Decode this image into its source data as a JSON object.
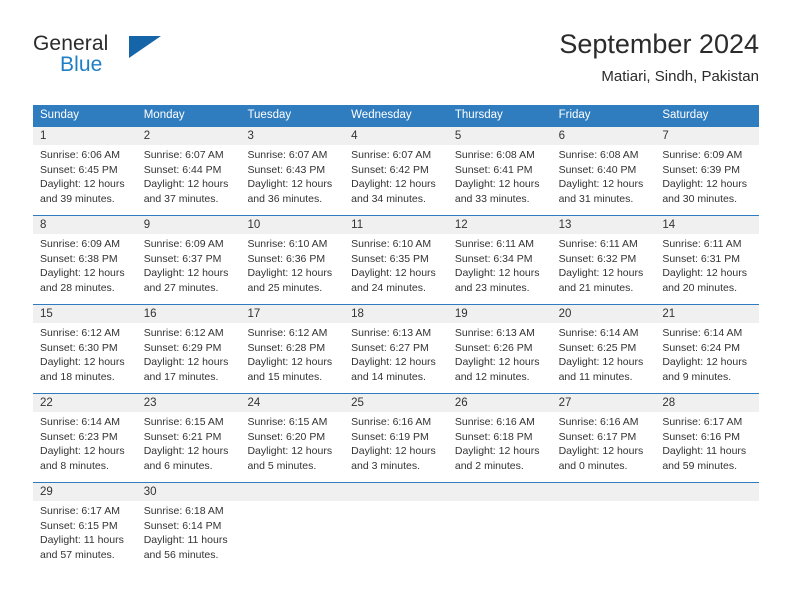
{
  "brand": {
    "name_part1": "General",
    "name_part2": "Blue",
    "triangle_color": "#1565a8",
    "blue_color": "#1f7fc4"
  },
  "header": {
    "title": "September 2024",
    "subtitle": "Matiari, Sindh, Pakistan"
  },
  "theme": {
    "header_blue": "#2f7cbf",
    "daynum_band": "#f0f0f0",
    "text": "#333333"
  },
  "weekdays": [
    "Sunday",
    "Monday",
    "Tuesday",
    "Wednesday",
    "Thursday",
    "Friday",
    "Saturday"
  ],
  "weeks": [
    [
      {
        "day": "1",
        "sunrise": "Sunrise: 6:06 AM",
        "sunset": "Sunset: 6:45 PM",
        "daylight1": "Daylight: 12 hours",
        "daylight2": "and 39 minutes."
      },
      {
        "day": "2",
        "sunrise": "Sunrise: 6:07 AM",
        "sunset": "Sunset: 6:44 PM",
        "daylight1": "Daylight: 12 hours",
        "daylight2": "and 37 minutes."
      },
      {
        "day": "3",
        "sunrise": "Sunrise: 6:07 AM",
        "sunset": "Sunset: 6:43 PM",
        "daylight1": "Daylight: 12 hours",
        "daylight2": "and 36 minutes."
      },
      {
        "day": "4",
        "sunrise": "Sunrise: 6:07 AM",
        "sunset": "Sunset: 6:42 PM",
        "daylight1": "Daylight: 12 hours",
        "daylight2": "and 34 minutes."
      },
      {
        "day": "5",
        "sunrise": "Sunrise: 6:08 AM",
        "sunset": "Sunset: 6:41 PM",
        "daylight1": "Daylight: 12 hours",
        "daylight2": "and 33 minutes."
      },
      {
        "day": "6",
        "sunrise": "Sunrise: 6:08 AM",
        "sunset": "Sunset: 6:40 PM",
        "daylight1": "Daylight: 12 hours",
        "daylight2": "and 31 minutes."
      },
      {
        "day": "7",
        "sunrise": "Sunrise: 6:09 AM",
        "sunset": "Sunset: 6:39 PM",
        "daylight1": "Daylight: 12 hours",
        "daylight2": "and 30 minutes."
      }
    ],
    [
      {
        "day": "8",
        "sunrise": "Sunrise: 6:09 AM",
        "sunset": "Sunset: 6:38 PM",
        "daylight1": "Daylight: 12 hours",
        "daylight2": "and 28 minutes."
      },
      {
        "day": "9",
        "sunrise": "Sunrise: 6:09 AM",
        "sunset": "Sunset: 6:37 PM",
        "daylight1": "Daylight: 12 hours",
        "daylight2": "and 27 minutes."
      },
      {
        "day": "10",
        "sunrise": "Sunrise: 6:10 AM",
        "sunset": "Sunset: 6:36 PM",
        "daylight1": "Daylight: 12 hours",
        "daylight2": "and 25 minutes."
      },
      {
        "day": "11",
        "sunrise": "Sunrise: 6:10 AM",
        "sunset": "Sunset: 6:35 PM",
        "daylight1": "Daylight: 12 hours",
        "daylight2": "and 24 minutes."
      },
      {
        "day": "12",
        "sunrise": "Sunrise: 6:11 AM",
        "sunset": "Sunset: 6:34 PM",
        "daylight1": "Daylight: 12 hours",
        "daylight2": "and 23 minutes."
      },
      {
        "day": "13",
        "sunrise": "Sunrise: 6:11 AM",
        "sunset": "Sunset: 6:32 PM",
        "daylight1": "Daylight: 12 hours",
        "daylight2": "and 21 minutes."
      },
      {
        "day": "14",
        "sunrise": "Sunrise: 6:11 AM",
        "sunset": "Sunset: 6:31 PM",
        "daylight1": "Daylight: 12 hours",
        "daylight2": "and 20 minutes."
      }
    ],
    [
      {
        "day": "15",
        "sunrise": "Sunrise: 6:12 AM",
        "sunset": "Sunset: 6:30 PM",
        "daylight1": "Daylight: 12 hours",
        "daylight2": "and 18 minutes."
      },
      {
        "day": "16",
        "sunrise": "Sunrise: 6:12 AM",
        "sunset": "Sunset: 6:29 PM",
        "daylight1": "Daylight: 12 hours",
        "daylight2": "and 17 minutes."
      },
      {
        "day": "17",
        "sunrise": "Sunrise: 6:12 AM",
        "sunset": "Sunset: 6:28 PM",
        "daylight1": "Daylight: 12 hours",
        "daylight2": "and 15 minutes."
      },
      {
        "day": "18",
        "sunrise": "Sunrise: 6:13 AM",
        "sunset": "Sunset: 6:27 PM",
        "daylight1": "Daylight: 12 hours",
        "daylight2": "and 14 minutes."
      },
      {
        "day": "19",
        "sunrise": "Sunrise: 6:13 AM",
        "sunset": "Sunset: 6:26 PM",
        "daylight1": "Daylight: 12 hours",
        "daylight2": "and 12 minutes."
      },
      {
        "day": "20",
        "sunrise": "Sunrise: 6:14 AM",
        "sunset": "Sunset: 6:25 PM",
        "daylight1": "Daylight: 12 hours",
        "daylight2": "and 11 minutes."
      },
      {
        "day": "21",
        "sunrise": "Sunrise: 6:14 AM",
        "sunset": "Sunset: 6:24 PM",
        "daylight1": "Daylight: 12 hours",
        "daylight2": "and 9 minutes."
      }
    ],
    [
      {
        "day": "22",
        "sunrise": "Sunrise: 6:14 AM",
        "sunset": "Sunset: 6:23 PM",
        "daylight1": "Daylight: 12 hours",
        "daylight2": "and 8 minutes."
      },
      {
        "day": "23",
        "sunrise": "Sunrise: 6:15 AM",
        "sunset": "Sunset: 6:21 PM",
        "daylight1": "Daylight: 12 hours",
        "daylight2": "and 6 minutes."
      },
      {
        "day": "24",
        "sunrise": "Sunrise: 6:15 AM",
        "sunset": "Sunset: 6:20 PM",
        "daylight1": "Daylight: 12 hours",
        "daylight2": "and 5 minutes."
      },
      {
        "day": "25",
        "sunrise": "Sunrise: 6:16 AM",
        "sunset": "Sunset: 6:19 PM",
        "daylight1": "Daylight: 12 hours",
        "daylight2": "and 3 minutes."
      },
      {
        "day": "26",
        "sunrise": "Sunrise: 6:16 AM",
        "sunset": "Sunset: 6:18 PM",
        "daylight1": "Daylight: 12 hours",
        "daylight2": "and 2 minutes."
      },
      {
        "day": "27",
        "sunrise": "Sunrise: 6:16 AM",
        "sunset": "Sunset: 6:17 PM",
        "daylight1": "Daylight: 12 hours",
        "daylight2": "and 0 minutes."
      },
      {
        "day": "28",
        "sunrise": "Sunrise: 6:17 AM",
        "sunset": "Sunset: 6:16 PM",
        "daylight1": "Daylight: 11 hours",
        "daylight2": "and 59 minutes."
      }
    ],
    [
      {
        "day": "29",
        "sunrise": "Sunrise: 6:17 AM",
        "sunset": "Sunset: 6:15 PM",
        "daylight1": "Daylight: 11 hours",
        "daylight2": "and 57 minutes."
      },
      {
        "day": "30",
        "sunrise": "Sunrise: 6:18 AM",
        "sunset": "Sunset: 6:14 PM",
        "daylight1": "Daylight: 11 hours",
        "daylight2": "and 56 minutes."
      },
      {
        "day": "",
        "sunrise": "",
        "sunset": "",
        "daylight1": "",
        "daylight2": ""
      },
      {
        "day": "",
        "sunrise": "",
        "sunset": "",
        "daylight1": "",
        "daylight2": ""
      },
      {
        "day": "",
        "sunrise": "",
        "sunset": "",
        "daylight1": "",
        "daylight2": ""
      },
      {
        "day": "",
        "sunrise": "",
        "sunset": "",
        "daylight1": "",
        "daylight2": ""
      },
      {
        "day": "",
        "sunrise": "",
        "sunset": "",
        "daylight1": "",
        "daylight2": ""
      }
    ]
  ]
}
